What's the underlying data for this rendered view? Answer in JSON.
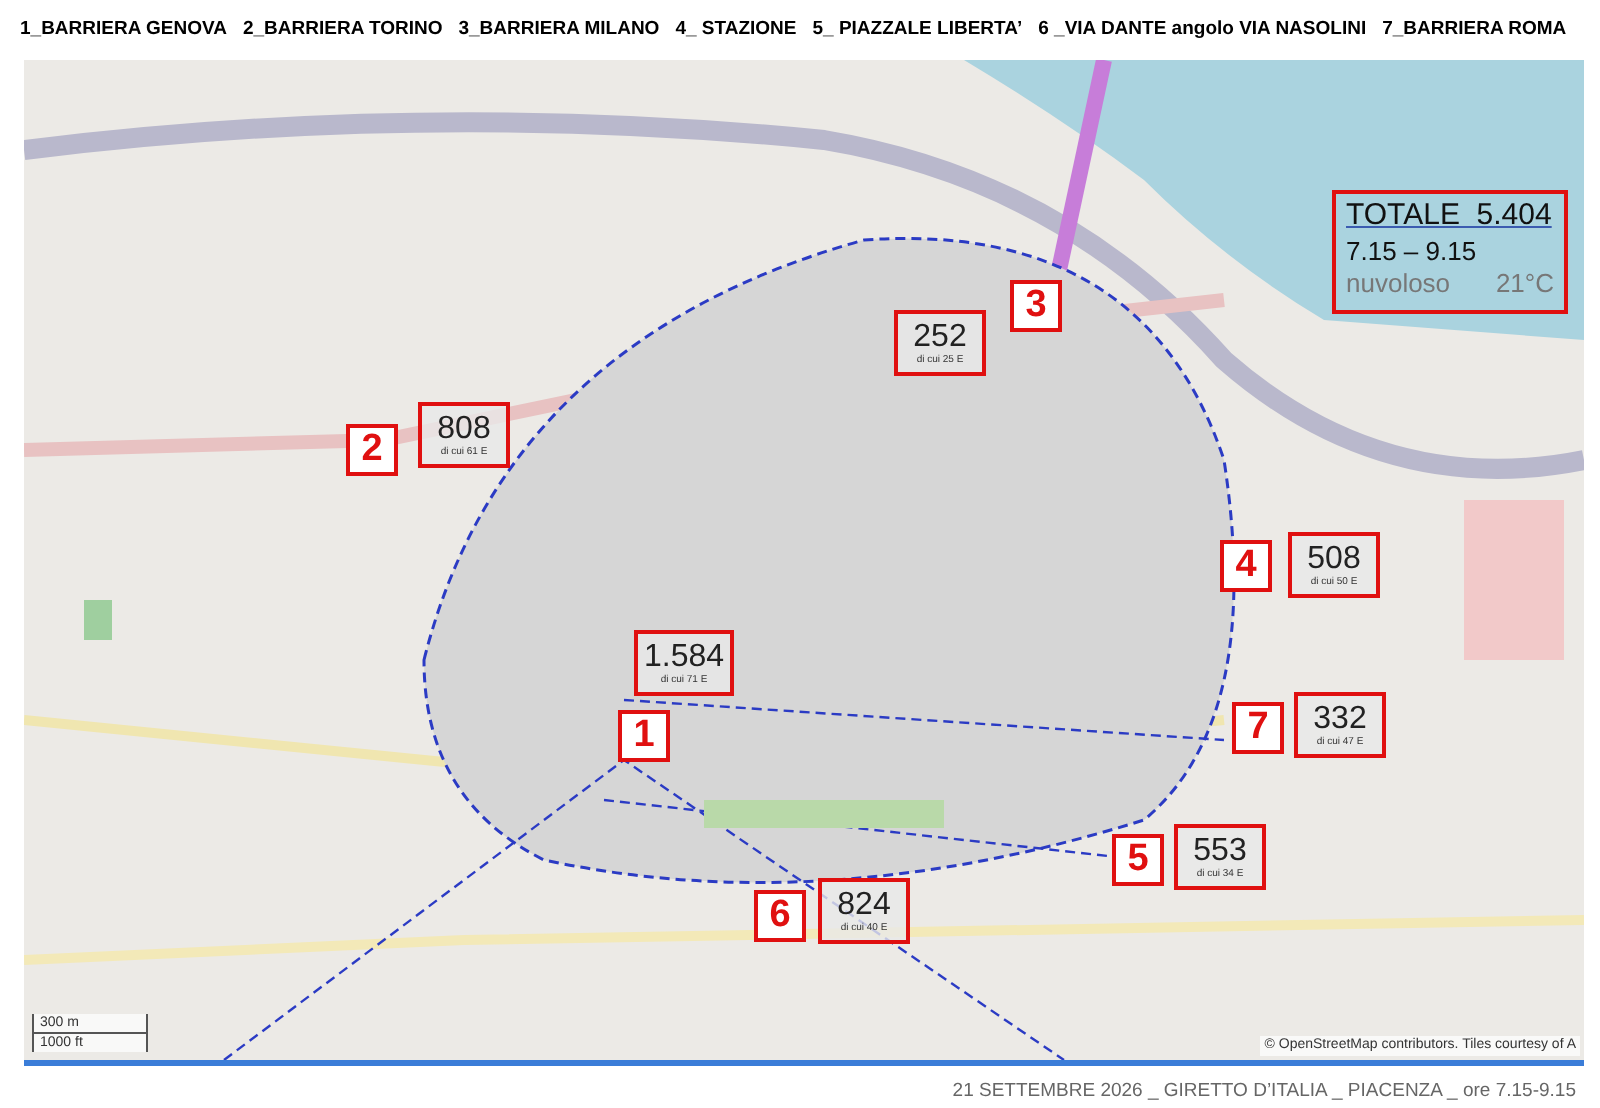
{
  "legend": [
    "1_BARRIERA GENOVA",
    "2_BARRIERA TORINO",
    "3_BARRIERA MILANO",
    "4_ STAZIONE",
    "5_ PIAZZALE LIBERTA’",
    "6 _VIA DANTE angolo VIA NASOLINI",
    "7_BARRIERA ROMA"
  ],
  "map": {
    "stations": [
      {
        "number": "1",
        "count": "1.584",
        "detail": "di cui 71 E"
      },
      {
        "number": "2",
        "count": "808",
        "detail": "di cui 61 E"
      },
      {
        "number": "3",
        "count": "252",
        "detail": "di cui 25 E"
      },
      {
        "number": "4",
        "count": "508",
        "detail": "di cui 50 E"
      },
      {
        "number": "5",
        "count": "553",
        "detail": "di cui 34 E"
      },
      {
        "number": "6",
        "count": "824",
        "detail": "di cui 40 E"
      },
      {
        "number": "7",
        "count": "332",
        "detail": "di cui 47 E"
      }
    ],
    "total": {
      "title": "TOTALE  5.404",
      "time": "7.15 – 9.15",
      "weather": "nuvoloso",
      "temperature": "21°C"
    },
    "scale": [
      "300 m",
      "1000 ft"
    ],
    "attribution": "© OpenStreetMap contributors. Tiles courtesy of A"
  },
  "footer": "21 SETTEMBRE 2026 _ GIRETTO D’ITALIA _ PIACENZA _ ore 7.15-9.15"
}
